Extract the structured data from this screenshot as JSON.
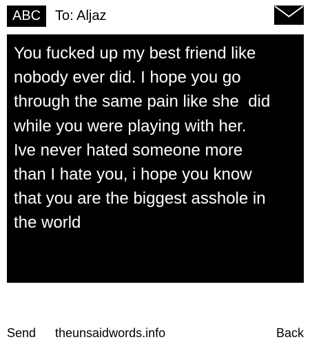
{
  "header": {
    "badge": "ABC",
    "recipient": "To: Aljaz",
    "mail_icon": "envelope-icon"
  },
  "message": {
    "text": "You fucked up my best friend like\nnobody ever did. I hope you go\nthrough the same pain like she  did\nwhile you were playing with her.\nIve never hated someone more\nthan I hate you, i hope you know\nthat you are the biggest asshole in\nthe world"
  },
  "footer": {
    "send_label": "Send",
    "site_label": "theunsaidwords.info",
    "back_label": "Back"
  },
  "colors": {
    "background": "#ffffff",
    "message_background": "#000000",
    "message_text": "#ffffff"
  }
}
